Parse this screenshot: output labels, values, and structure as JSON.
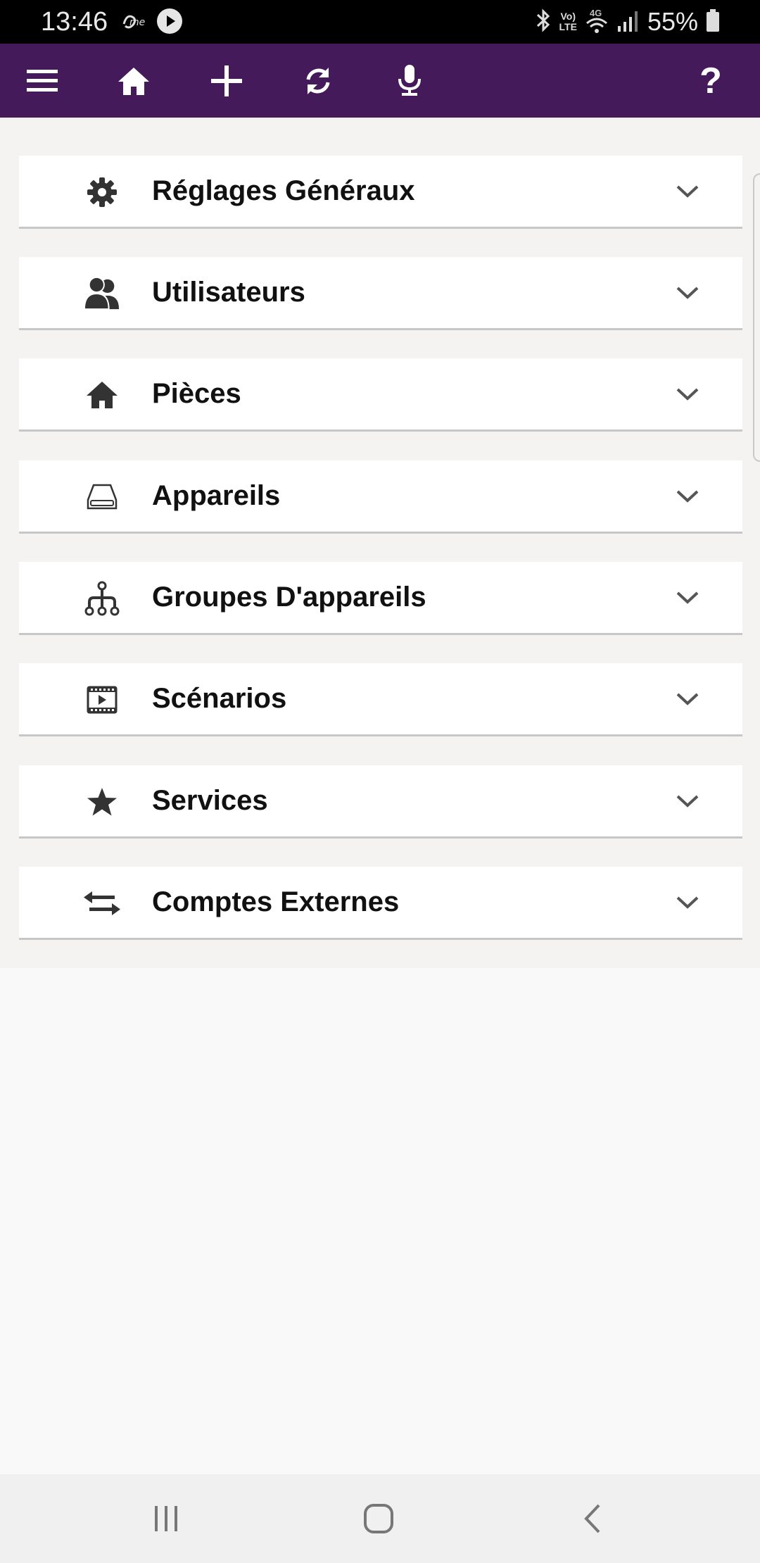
{
  "status_bar": {
    "time": "13:46",
    "battery_percent": "55%",
    "network_lines": [
      "Vo)",
      "LTE"
    ],
    "network_type": "4G",
    "icons": [
      "orange-me-icon",
      "play-icon",
      "bluetooth-icon",
      "wifi-icon",
      "signal-icon",
      "battery-icon"
    ]
  },
  "toolbar": {
    "background_color": "#451a5a",
    "buttons": [
      "menu-icon",
      "home-icon",
      "plus-icon",
      "refresh-icon",
      "microphone-icon"
    ],
    "help_label": "?"
  },
  "menu": {
    "items": [
      {
        "label": "Réglages Généraux",
        "icon": "gear-icon"
      },
      {
        "label": "Utilisateurs",
        "icon": "users-icon"
      },
      {
        "label": "Pièces",
        "icon": "home-icon"
      },
      {
        "label": "Appareils",
        "icon": "device-icon"
      },
      {
        "label": "Groupes D'appareils",
        "icon": "device-group-icon"
      },
      {
        "label": "Scénarios",
        "icon": "scenario-film-icon"
      },
      {
        "label": "Services",
        "icon": "star-icon"
      },
      {
        "label": "Comptes Externes",
        "icon": "exchange-arrows-icon"
      }
    ]
  },
  "nav_bar": {
    "buttons": [
      "recent-apps-icon",
      "home-button-icon",
      "back-icon"
    ]
  }
}
